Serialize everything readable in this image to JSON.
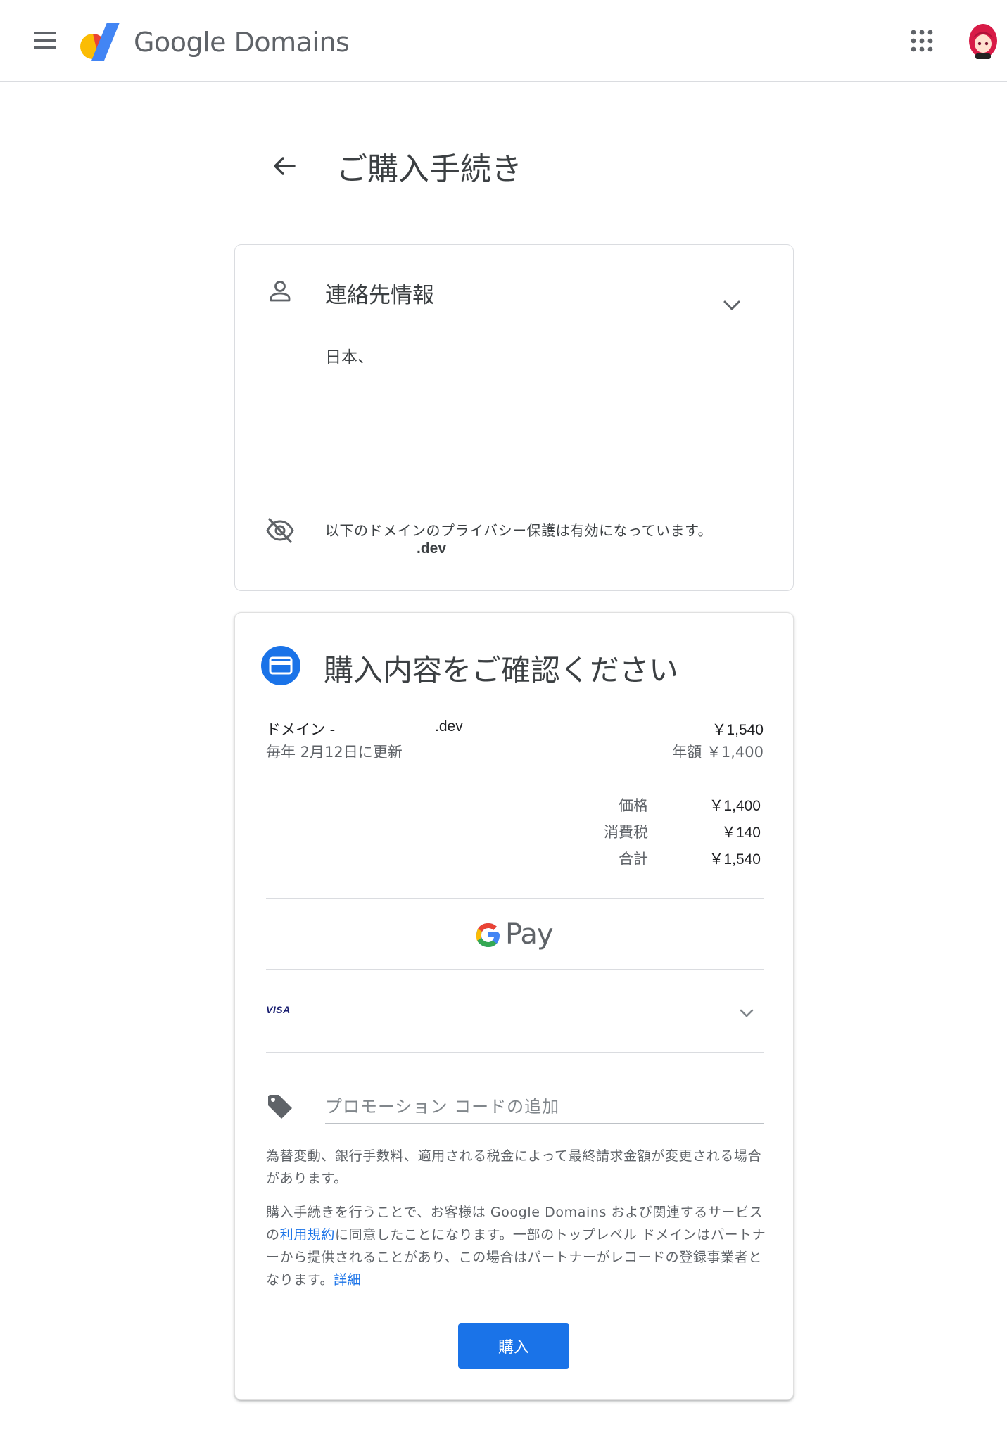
{
  "header": {
    "brand": "Google Domains",
    "icons": {
      "menu": "menu-icon",
      "logo": "google-domains-logo",
      "apps": "apps-grid-icon",
      "avatar": "user-avatar"
    }
  },
  "page": {
    "title": "ご購入手続き",
    "back_icon": "arrow-back-icon"
  },
  "contact": {
    "title": "連絡先情報",
    "country": "日本、",
    "privacy_notice": "以下のドメインのプライバシー保護は有効になっています。",
    "privacy_domain": ".dev",
    "icons": {
      "person": "person-icon",
      "expand": "chevron-down-icon",
      "privacy": "visibility-off-icon"
    }
  },
  "order": {
    "title": "購入内容をご確認ください",
    "item": {
      "name": "ドメイン -",
      "tld": ".dev",
      "price": "￥1,540",
      "renewal": "毎年 2月12日に更新",
      "annual": "年額 ￥1,400"
    },
    "summary": [
      {
        "label": "価格",
        "value": "￥1,400"
      },
      {
        "label": "消費税",
        "value": "￥140"
      },
      {
        "label": "合計",
        "value": "￥1,540"
      }
    ],
    "payment": {
      "provider": "Pay",
      "card_brand": "VISA"
    },
    "promo": {
      "placeholder": "プロモーション コードの追加"
    },
    "note_exchange": "為替変動、銀行手数料、適用される税金によって最終請求金額が変更される場合があります。",
    "note_terms_before": "購入手続きを行うことで、お客様は Google Domains および関連するサービスの",
    "note_terms_link": "利用規約",
    "note_terms_after": "に同意したことになります。一部のトップレベル ドメインはパートナーから提供されることがあり、この場合はパートナーがレコードの登録事業者となります。",
    "note_details_link": "詳細",
    "buy_label": "購入",
    "colors": {
      "accent": "#1a73e8",
      "google_blue": "#4285f4",
      "google_red": "#ea4335",
      "google_yellow": "#fbbc04",
      "google_green": "#34a853"
    }
  }
}
